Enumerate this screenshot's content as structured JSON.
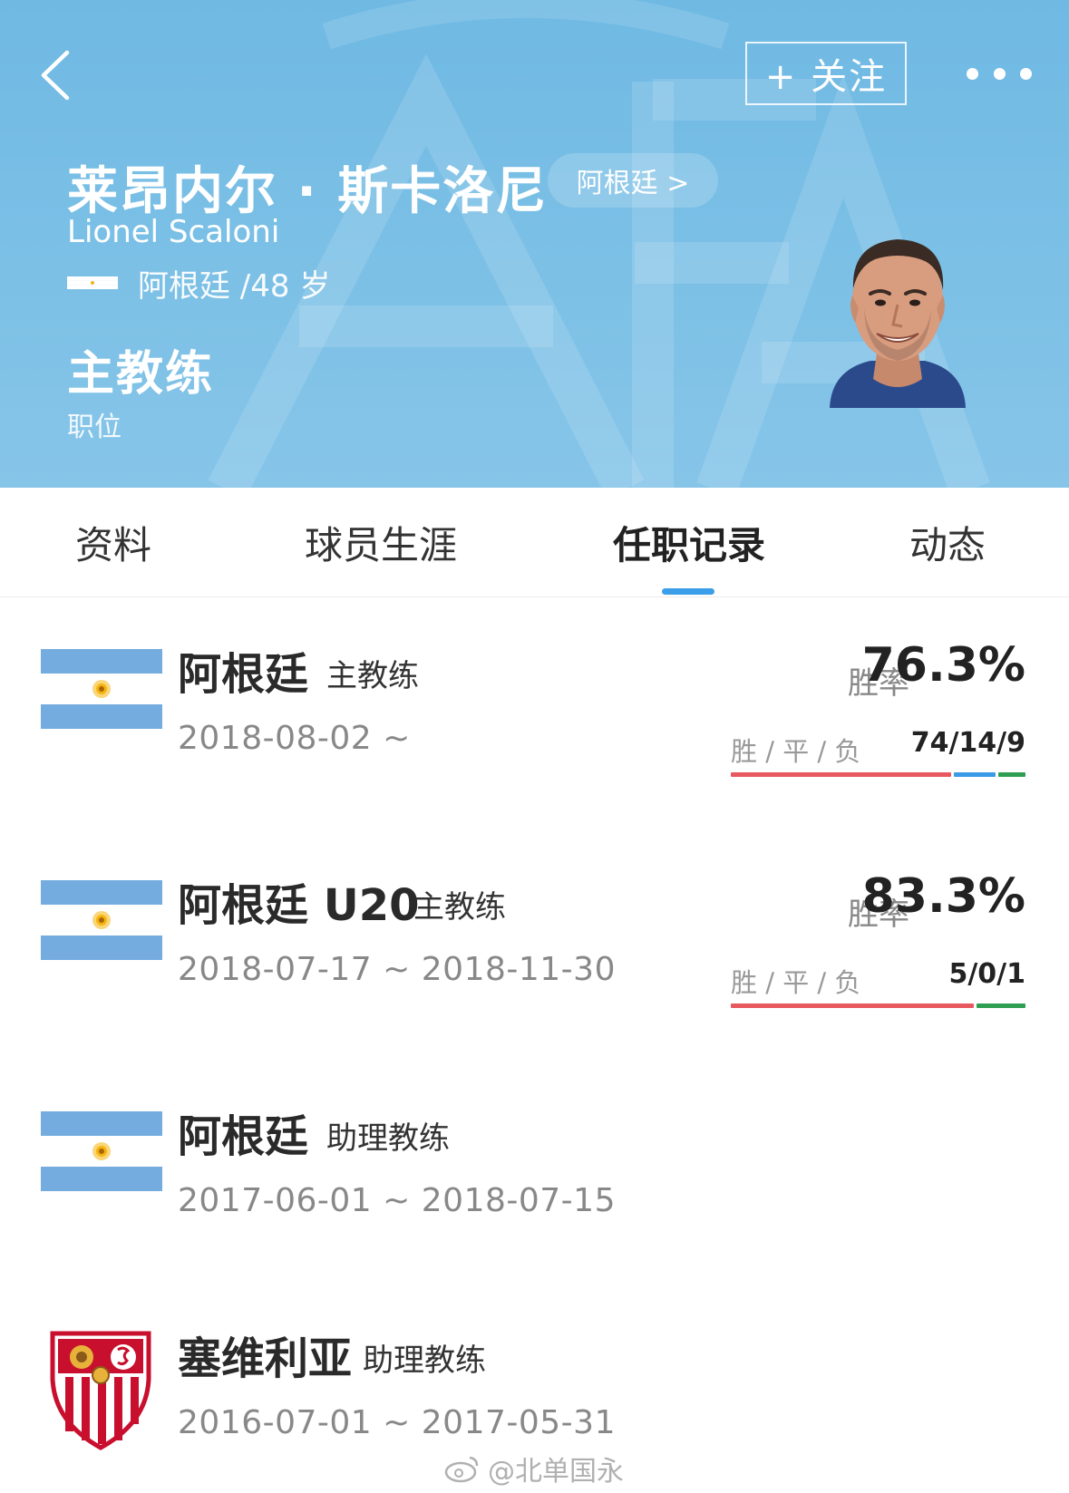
{
  "header": {
    "follow_label": "+ 关注",
    "name_cn": "莱昂内尔 · 斯卡洛尼",
    "country_link": "阿根廷 >",
    "name_en": "Lionel Scaloni",
    "nationality_age": "阿根廷 /48 岁",
    "position": "主教练",
    "position_label": "职位",
    "colors": {
      "bg_top": "#6fb9e3",
      "bg_bottom": "#86c5e8"
    }
  },
  "tabs": [
    {
      "label": "资料",
      "active": false
    },
    {
      "label": "球员生涯",
      "active": false
    },
    {
      "label": "任职记录",
      "active": true
    },
    {
      "label": "动态",
      "active": false
    }
  ],
  "records": [
    {
      "team": "阿根廷",
      "role": "主教练",
      "dates": "2018-08-02 ~",
      "winrate_label": "胜率",
      "winrate": "76.3%",
      "wdl_label": "胜 / 平 / 负",
      "wdl": "74/14/9",
      "wins": 74,
      "draws": 14,
      "losses": 9,
      "icon": "argentina-flag-icon"
    },
    {
      "team": "阿根廷 U20",
      "role": "主教练",
      "dates": "2018-07-17 ~ 2018-11-30",
      "winrate_label": "胜率",
      "winrate": "83.3%",
      "wdl_label": "胜 / 平 / 负",
      "wdl": "5/0/1",
      "wins": 5,
      "draws": 0,
      "losses": 1,
      "icon": "argentina-flag-icon"
    },
    {
      "team": "阿根廷",
      "role": "助理教练",
      "dates": "2017-06-01 ~ 2018-07-15",
      "icon": "argentina-flag-icon"
    },
    {
      "team": "塞维利亚",
      "role": "助理教练",
      "dates": "2016-07-01 ~ 2017-05-31",
      "icon": "sevilla-crest-icon"
    }
  ],
  "wdl_colors": {
    "win": "#e8585f",
    "draw": "#3b9be6",
    "loss": "#2e9e52"
  },
  "accent": "#3a9ee8",
  "watermark": "@北单国永"
}
